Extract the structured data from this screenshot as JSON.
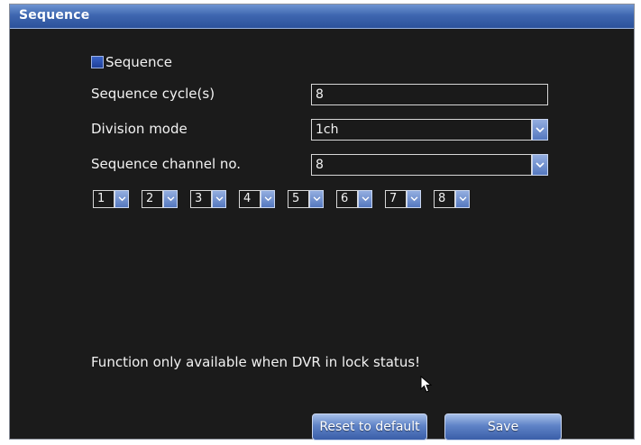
{
  "window": {
    "title": "Sequence"
  },
  "sequence_toggle": {
    "label": "Sequence",
    "checked": true
  },
  "fields": {
    "cycle": {
      "label": "Sequence cycle(s)",
      "value": "8"
    },
    "division_mode": {
      "label": "Division mode",
      "value": "1ch"
    },
    "channel_no": {
      "label": "Sequence channel no.",
      "value": "8"
    }
  },
  "channel_selects": [
    {
      "value": "1"
    },
    {
      "value": "2"
    },
    {
      "value": "3"
    },
    {
      "value": "4"
    },
    {
      "value": "5"
    },
    {
      "value": "6"
    },
    {
      "value": "7"
    },
    {
      "value": "8"
    }
  ],
  "notice": "Function only available when DVR in lock status!",
  "buttons": {
    "reset": "Reset to default",
    "save": "Save"
  },
  "colors": {
    "background": "#1b1b1b",
    "titlebar": "#3f67b0",
    "accent": "#5f83c7",
    "text": "#f2f2f2"
  },
  "icons": {
    "dropdown": "chevron-down-icon",
    "pointer": "mouse-pointer-icon",
    "checkbox": "checkbox-checked-icon"
  }
}
